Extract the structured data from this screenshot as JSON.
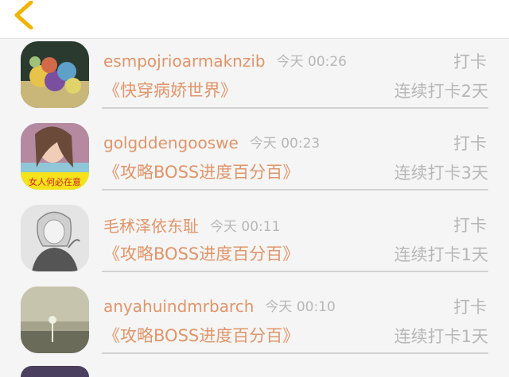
{
  "header": {
    "back_icon": "chevron-left-icon",
    "back_color": "#f0b400"
  },
  "colors": {
    "accent": "#e0956a",
    "muted": "#b7b7b7",
    "divider": "#d2d2d2"
  },
  "entries": [
    {
      "username": "esmpojrioarmaknzib",
      "time": "今天 00:26",
      "action": "打卡",
      "book": "《快穿病娇世界》",
      "streak": "连续打卡2天",
      "avatar_alt": "balloons-photo-avatar"
    },
    {
      "username": "golgddengooswe",
      "time": "今天 00:23",
      "action": "打卡",
      "book": "《攻略BOSS进度百分百》",
      "streak": "连续打卡3天",
      "avatar_alt": "girl-photo-avatar",
      "avatar_caption": "女人何必在意"
    },
    {
      "username": "毛秫泽依东耻",
      "time": "今天 00:11",
      "action": "打卡",
      "book": "《攻略BOSS进度百分百》",
      "streak": "连续打卡1天",
      "avatar_alt": "anime-boy-avatar"
    },
    {
      "username": "anyahuindmrbarch",
      "time": "今天 00:10",
      "action": "打卡",
      "book": "《攻略BOSS进度百分百》",
      "streak": "连续打卡1天",
      "avatar_alt": "landscape-avatar"
    }
  ]
}
